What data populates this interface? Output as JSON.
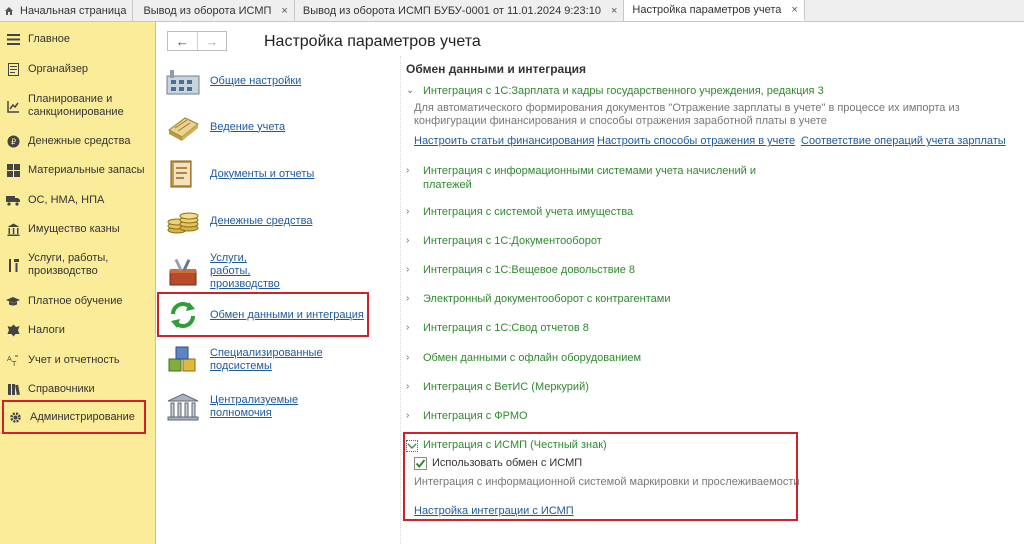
{
  "tabs": [
    {
      "label": "Начальная страница",
      "closable": false,
      "active": false
    },
    {
      "label": "Вывод из оборота ИСМП",
      "closable": true,
      "active": false
    },
    {
      "label": "Вывод из оборота ИСМП БУБУ-0001 от 11.01.2024 9:23:10",
      "closable": true,
      "active": false
    },
    {
      "label": "Настройка параметров учета",
      "closable": true,
      "active": true
    }
  ],
  "tab_close_glyph": "×",
  "sidebar": {
    "items": [
      {
        "label": "Главное",
        "icon": "menu-icon"
      },
      {
        "label": "Органайзер",
        "icon": "notepad-icon"
      },
      {
        "label": "Планирование и санкционирование",
        "icon": "chart-icon"
      },
      {
        "label": "Денежные средства",
        "icon": "coin-icon"
      },
      {
        "label": "Материальные запасы",
        "icon": "grid-icon"
      },
      {
        "label": "ОС, НМА, НПА",
        "icon": "truck-icon"
      },
      {
        "label": "Имущество казны",
        "icon": "building-icon"
      },
      {
        "label": "Услуги, работы, производство",
        "icon": "tools-icon"
      },
      {
        "label": "Платное обучение",
        "icon": "graduation-cap-icon"
      },
      {
        "label": "Налоги",
        "icon": "emblem-icon"
      },
      {
        "label": "Учет и отчетность",
        "icon": "accounting-icon"
      },
      {
        "label": "Справочники",
        "icon": "books-icon"
      },
      {
        "label": "Администрирование",
        "icon": "gear-icon"
      }
    ]
  },
  "nav": {
    "back": "←",
    "forward": "→"
  },
  "page_title": "Настройка параметров учета",
  "sections": [
    {
      "label": "Общие настройки",
      "icon": "factory-icon"
    },
    {
      "label": "Ведение учета",
      "icon": "ledger-icon"
    },
    {
      "label": "Документы и отчеты",
      "icon": "documents-icon"
    },
    {
      "label": "Денежные средства",
      "icon": "coins-stack-icon"
    },
    {
      "label": "Услуги, работы, производство",
      "icon": "toolbox-icon"
    },
    {
      "label": "Обмен данными и интеграция",
      "icon": "sync-icon"
    },
    {
      "label": "Специализированные подсистемы",
      "icon": "cubes-icon"
    },
    {
      "label": "Централизуемые полномочия",
      "icon": "institution-icon"
    }
  ],
  "right": {
    "header": "Обмен данными и интеграция",
    "zup": {
      "title": "Интеграция с 1С:Зарплата и кадры государственного учреждения, редакция 3",
      "desc": "Для автоматического формирования документов \"Отражение зарплаты в учете\" в процессе их импорта из конфигурации финансирования и способы отражения заработной платы в учете",
      "links": [
        "Настроить статьи финансирования",
        "Настроить способы отражения в учете",
        "Соответствие операций учета зарплаты"
      ]
    },
    "groups": [
      "Интеграция с информационными системами учета начислений и платежей",
      "Интеграция с системой учета имущества",
      "Интеграция с 1С:Документооборот",
      "Интеграция с 1С:Вещевое довольствие 8",
      "Электронный документооборот с контрагентами",
      "Интеграция с 1С:Свод отчетов 8",
      "Обмен данными с офлайн оборудованием",
      "Интеграция с ВетИС (Меркурий)",
      "Интеграция с ФРМО"
    ],
    "ismp": {
      "title": "Интеграция с ИСМП (Честный знак)",
      "checkbox_label": "Использовать обмен с ИСМП",
      "checked": true,
      "desc": "Интеграция с информационной системой маркировки и прослеживаемости",
      "link": "Настройка интеграции с ИСМП"
    }
  },
  "colors": {
    "accent_green": "#2f8a2f",
    "link_blue": "#1e5a9b",
    "highlight_red": "#d0202a",
    "sidebar_bg": "#fbec9a"
  }
}
